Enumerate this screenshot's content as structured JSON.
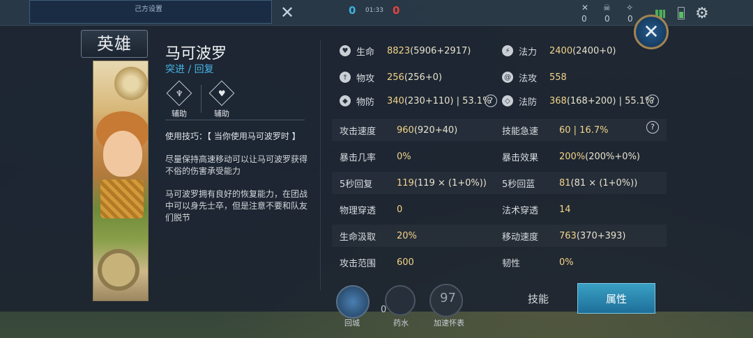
{
  "hud": {
    "top_caption": "己方设置",
    "score_left": "0",
    "score_right": "0",
    "timer": "01:33",
    "kills": "0",
    "deaths": "0",
    "assists": "0"
  },
  "panel": {
    "tab_label": "英雄",
    "hero_name": "马可波罗",
    "hero_class": "突进 / 回复",
    "roles": [
      "辅助",
      "辅助"
    ],
    "tip_title": "使用技巧：【 当你使用马可波罗时 】",
    "tip_paragraphs": [
      "尽量保持高速移动可以让马可波罗获得不俗的伤害承受能力",
      "马可波罗拥有良好的恢复能力，在团战中可以身先士卒，但是注意不要和队友们脱节"
    ]
  },
  "stats": {
    "hp": {
      "label": "生命",
      "value": "8823",
      "detail": "(5906+2917)",
      "icon": "heart-icon"
    },
    "mana": {
      "label": "法力",
      "value": "2400",
      "detail": "(2400+0)",
      "icon": "lightning-icon"
    },
    "phys_atk": {
      "label": "物攻",
      "value": "256",
      "detail": "(256+0)",
      "icon": "sword-icon"
    },
    "mag_atk": {
      "label": "法攻",
      "value": "558",
      "detail": "",
      "icon": "swirl-icon"
    },
    "phys_def": {
      "label": "物防",
      "value": "340",
      "detail": "(230+110) | 53.1%",
      "icon": "shield-icon"
    },
    "mag_def": {
      "label": "法防",
      "value": "368",
      "detail": "(168+200) | 55.1%",
      "icon": "magic-shield-icon"
    },
    "rows": [
      {
        "l_label": "攻击速度",
        "l_value": "960",
        "l_detail": "(920+40)",
        "r_label": "技能急速",
        "r_value": "60 | 16.7%",
        "r_detail": ""
      },
      {
        "l_label": "暴击几率",
        "l_value": "0%",
        "l_detail": "",
        "r_label": "暴击效果",
        "r_value": "200%",
        "r_detail": "(200%+0%)"
      },
      {
        "l_label": "5秒回复",
        "l_value": "119",
        "l_detail": "(119 × (1+0%))",
        "r_label": "5秒回蓝",
        "r_value": "81",
        "r_detail": "(81 × (1+0%))"
      },
      {
        "l_label": "物理穿透",
        "l_value": "0",
        "l_detail": "",
        "r_label": "法术穿透",
        "r_value": "14",
        "r_detail": ""
      },
      {
        "l_label": "生命汲取",
        "l_value": "20%",
        "l_detail": "",
        "r_label": "移动速度",
        "r_value": "763",
        "r_detail": "(370+393)"
      },
      {
        "l_label": "攻击范围",
        "l_value": "600",
        "l_detail": "",
        "r_label": "韧性",
        "r_value": "0%",
        "r_detail": ""
      }
    ]
  },
  "tabs": {
    "skill": "技能",
    "attributes": "属性"
  },
  "bottom": {
    "recall": "回城",
    "potion": "药水",
    "speed": "加速怀表",
    "potion_count": "0",
    "speed_count": "97"
  },
  "colors": {
    "accent_blue": "#46b6e8",
    "value_gold": "#f3d48a",
    "panel_bg": "#1c2430"
  }
}
